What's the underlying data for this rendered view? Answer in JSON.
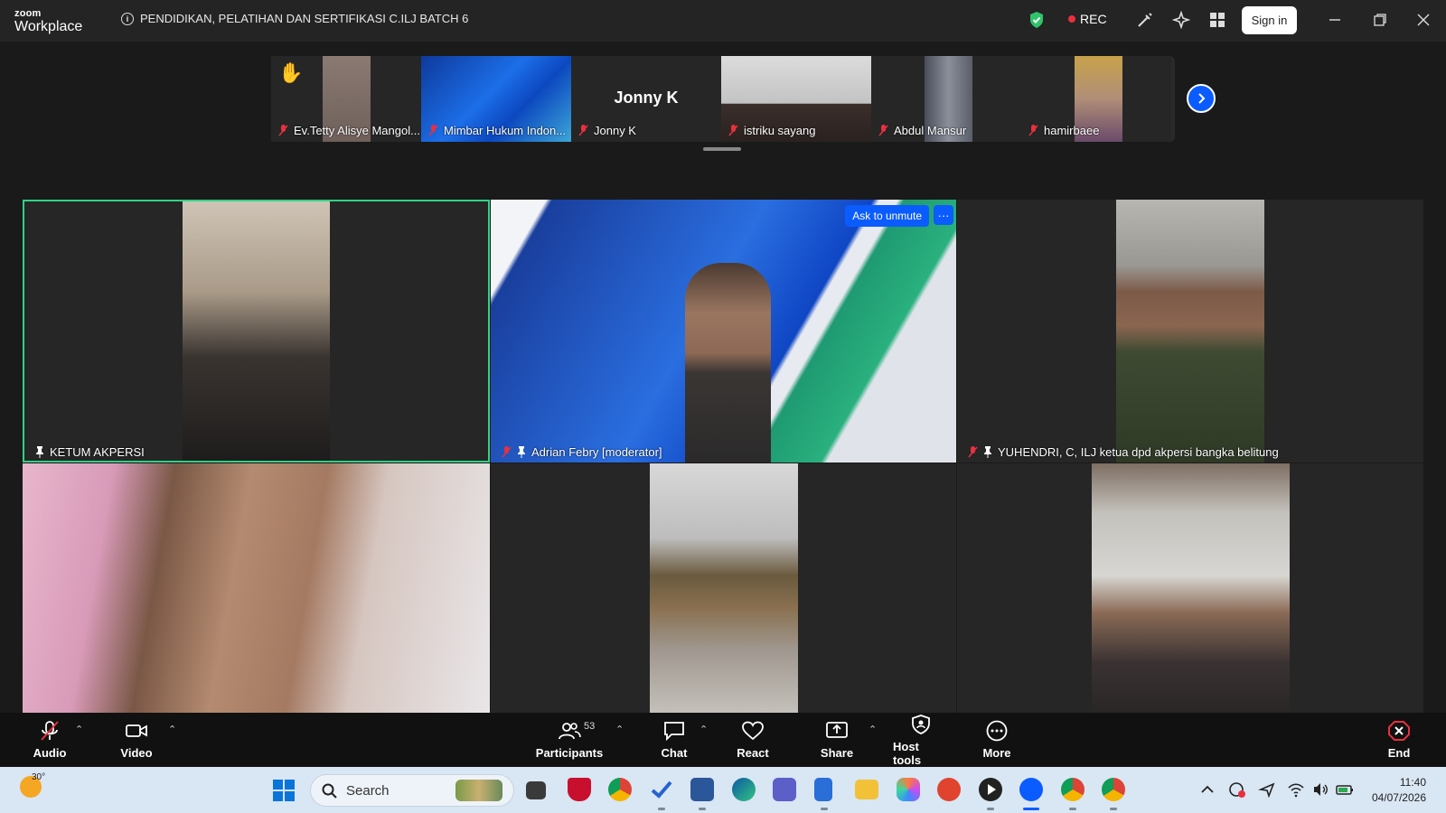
{
  "app": {
    "brand_top": "zoom",
    "brand_bottom": "Workplace",
    "meeting_title": "PENDIDIKAN, PELATIHAN DAN SERTIFIKASI C.ILJ BATCH 6",
    "rec_label": "REC",
    "signin_label": "Sign in"
  },
  "filmstrip": {
    "thumbnails": [
      {
        "name": "Ev.Tetty Alisye Mangol..."
      },
      {
        "name": "Mimbar Hukum Indon..."
      },
      {
        "name": "Jonny K",
        "center_name": "Jonny K"
      },
      {
        "name": "istriku sayang"
      },
      {
        "name": "Abdul Mansur"
      },
      {
        "name": "hamirbaee"
      }
    ]
  },
  "gallery": {
    "tiles": [
      {
        "name": "KETUM AKPERSI"
      },
      {
        "name": "Adrian Febry [moderator]",
        "ask_label": "Ask to unmute",
        "more_label": "···"
      },
      {
        "name": "YUHENDRI, C, ILJ ketua dpd akpersi bangka belitung"
      },
      {
        "name": ""
      },
      {
        "name": ""
      },
      {
        "name": ""
      }
    ]
  },
  "controls": {
    "audio": "Audio",
    "video": "Video",
    "participants": "Participants",
    "participants_count": "53",
    "chat": "Chat",
    "react": "React",
    "share": "Share",
    "host_tools": "Host tools",
    "more": "More",
    "end": "End"
  },
  "taskbar": {
    "weather_temp": "30°",
    "search_placeholder": "Search",
    "time": "11:40",
    "date": "04/07/2026"
  },
  "colors": {
    "zoom_blue": "#0b5cff",
    "active_speaker": "#2fd386",
    "rec_red": "#e8303f",
    "end_red": "#e8303f"
  }
}
